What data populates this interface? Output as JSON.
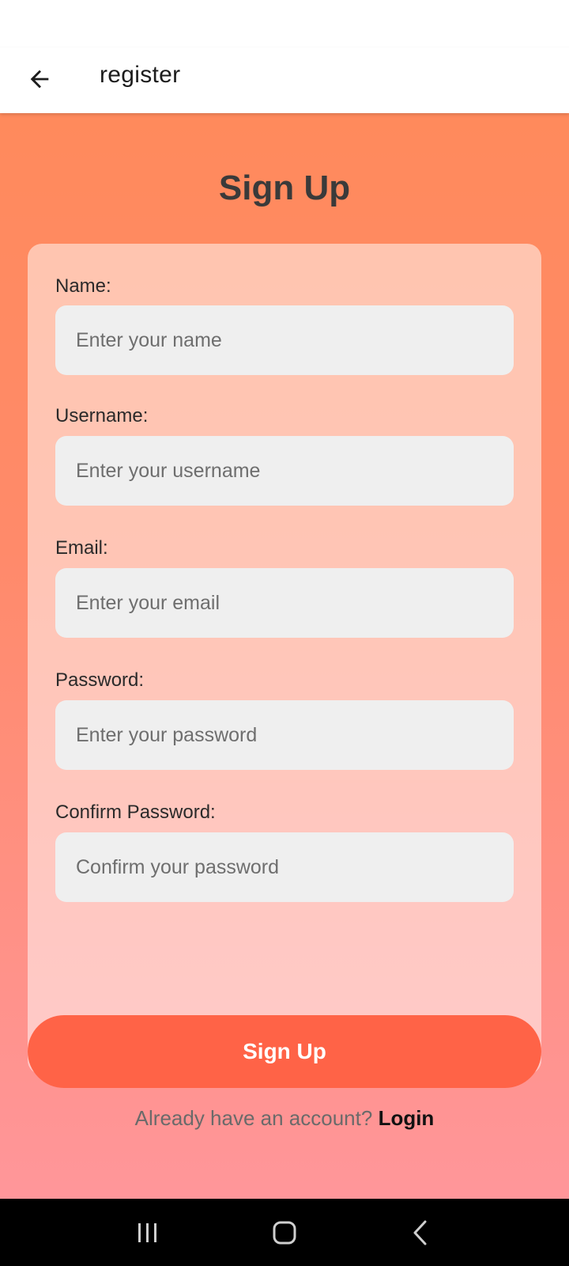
{
  "app_bar": {
    "back_icon": "arrow-left-icon",
    "title": "register"
  },
  "page": {
    "heading": "Sign Up"
  },
  "form": {
    "fields": [
      {
        "label": "Name:",
        "placeholder": "Enter your name",
        "value": ""
      },
      {
        "label": "Username:",
        "placeholder": "Enter your username",
        "value": ""
      },
      {
        "label": "Email:",
        "placeholder": "Enter your email",
        "value": ""
      },
      {
        "label": "Password:",
        "placeholder": "Enter your password",
        "value": ""
      },
      {
        "label": "Confirm Password:",
        "placeholder": "Confirm your password",
        "value": ""
      }
    ],
    "submit_label": "Sign Up"
  },
  "footer": {
    "prompt": "Already have an account?",
    "login_label": "Login"
  },
  "system_nav": {
    "icons": [
      "recent-apps-icon",
      "home-icon",
      "back-icon"
    ]
  },
  "colors": {
    "accent": "#ff6347",
    "gradient_top": "#ff8a5c",
    "gradient_bottom": "#ff969a"
  }
}
